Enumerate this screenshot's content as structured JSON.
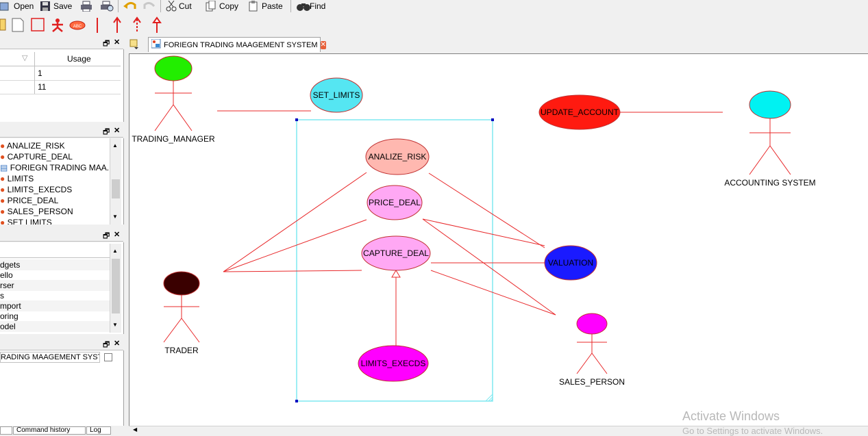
{
  "toolbar": {
    "open": "Open",
    "save": "Save",
    "cut": "Cut",
    "copy": "Copy",
    "paste": "Paste",
    "find": "Find"
  },
  "props_table": {
    "header_usage": "Usage",
    "rows": [
      "1",
      "11"
    ]
  },
  "tree": {
    "items": [
      "ANALIZE_RISK",
      "CAPTURE_DEAL",
      "FORIEGN TRADING MAA...",
      "LIMITS",
      "LIMITS_EXECDS",
      "PRICE_DEAL",
      "SALES_PERSON",
      "SET LIMITS"
    ]
  },
  "list3": {
    "items": [
      "dgets",
      "ello",
      "rser",
      "s",
      "mport",
      "oring",
      "odel"
    ]
  },
  "diagram_select": "RADING MAAGEMENT SYSTEM",
  "bottom_tabs": [
    "Command history",
    "Log"
  ],
  "tab_title": "FORIEGN TRADING MAAGEMENT SYSTEM",
  "actors": {
    "trading_manager": "TRADING_MANAGER",
    "accounting": "ACCOUNTING SYSTEM",
    "trader": "TRADER",
    "sales_person": "SALES_PERSON"
  },
  "usecases": {
    "set_limits": "SET_LIMITS",
    "update_account": "UPDATE_ACCOUNT",
    "analize_risk": "ANALIZE_RISK",
    "price_deal": "PRICE_DEAL",
    "capture_deal": "CAPTURE_DEAL",
    "valuation": "VALUATION",
    "limits_execds": "LIMITS_EXECDS"
  },
  "watermark": {
    "line1": "Activate Windows",
    "line2": "Go to Settings to activate Windows."
  },
  "colors": {
    "line": "#e8282a",
    "trading_manager_head": "#22ee00",
    "accounting_head": "#00f2f2",
    "trader_head": "#3a0000",
    "sales_head": "#ff00ff",
    "set_limits": "#55e6f2",
    "update_account": "#ff1a10",
    "analize_risk": "#ffb8b0",
    "price_deal": "#ffa8f4",
    "capture_deal": "#ffa8f4",
    "valuation": "#1a1aff",
    "limits_execds": "#ff00ff",
    "boundary": "#7fe8f0"
  }
}
